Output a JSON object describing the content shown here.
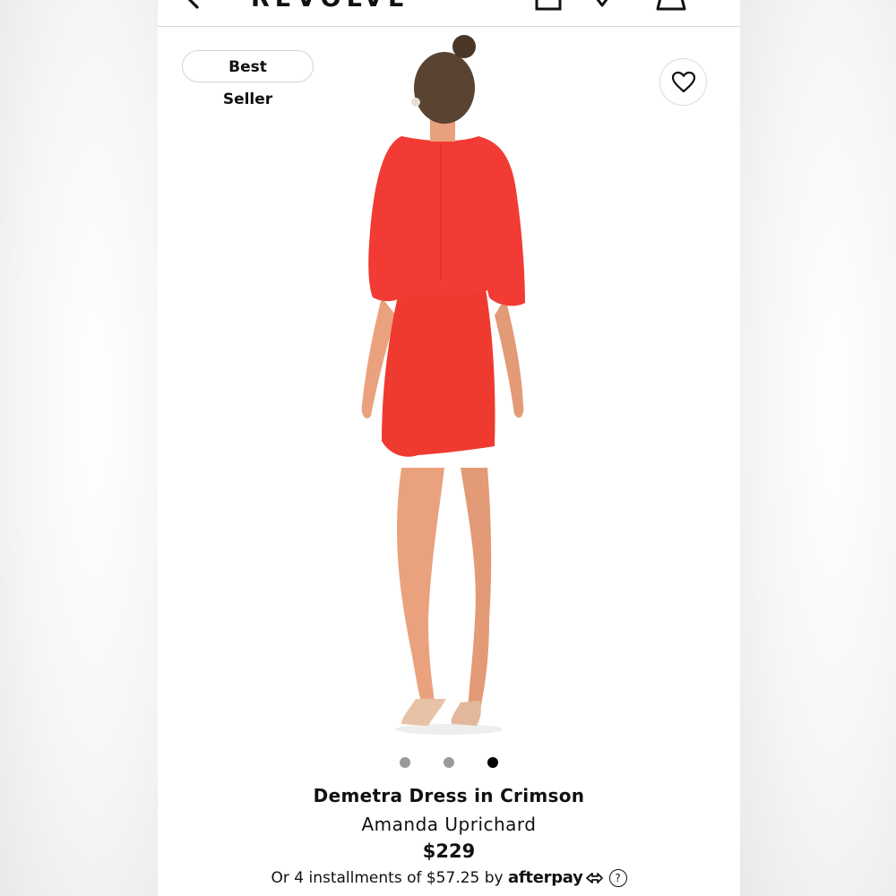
{
  "header": {
    "logo": "REVOLVE",
    "icons": [
      "back-arrow-icon",
      "shopping-bag-icon",
      "heart-icon",
      "account-icon"
    ]
  },
  "badge": {
    "label": "Best Seller"
  },
  "favorite": {
    "icon": "heart-outline-icon"
  },
  "gallery": {
    "image_count": 3,
    "active_index": 2
  },
  "product": {
    "title": "Demetra Dress in Crimson",
    "brand": "Amanda Uprichard",
    "price": "$229"
  },
  "payment": {
    "prefix": "Or 4 installments of $57.25 by",
    "provider": "afterpay",
    "help_glyph": "?"
  },
  "colors": {
    "dress": "#f23b34",
    "text": "#111111",
    "dot_inactive": "#9a9a9a",
    "dot_active": "#000000"
  }
}
